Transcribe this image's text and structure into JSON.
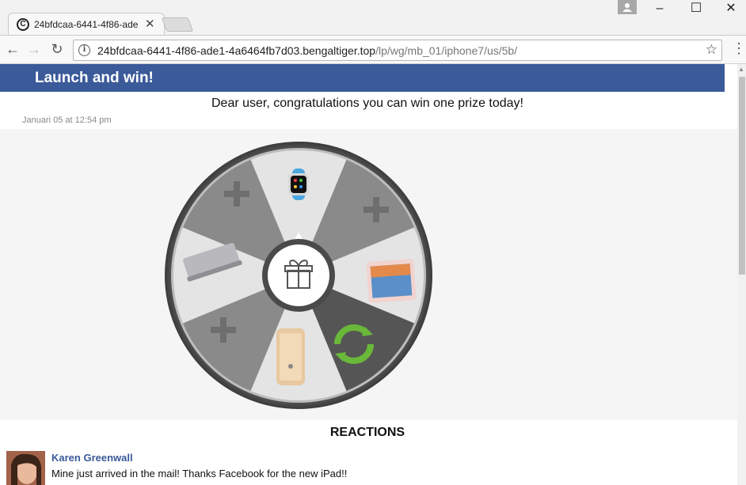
{
  "browser": {
    "tab_title": "24bfdcaa-6441-4f86-ade",
    "tab_close": "✕",
    "url_host": "24bfdcaa-6441-4f86-ade1-4a6464fb7d03.bengaltiger.top",
    "url_path": "/lp/wg/mb_01/iphone7/us/5b/",
    "window_controls": [
      "–",
      "☐",
      "✕"
    ]
  },
  "page": {
    "header_title": "Launch and win!",
    "congrats_text": "Dear user, congratulations you can win one prize today!",
    "date_text": "Januari 05 at 12:54 pm",
    "wheel_segments": [
      "apple-watch",
      "plus",
      "ipad",
      "retry",
      "iphone",
      "plus",
      "macbook",
      "plus"
    ],
    "reactions_title": "REACTIONS",
    "comments": [
      {
        "author": "Karen Greenwall",
        "text": "Mine just arrived in the mail! Thanks Facebook for the new iPad!!"
      }
    ]
  },
  "colors": {
    "fb_blue": "#3b5a9a",
    "wheel_dark": "#555555",
    "wheel_light": "#e4e4e4",
    "retry_green": "#6ab83a"
  }
}
